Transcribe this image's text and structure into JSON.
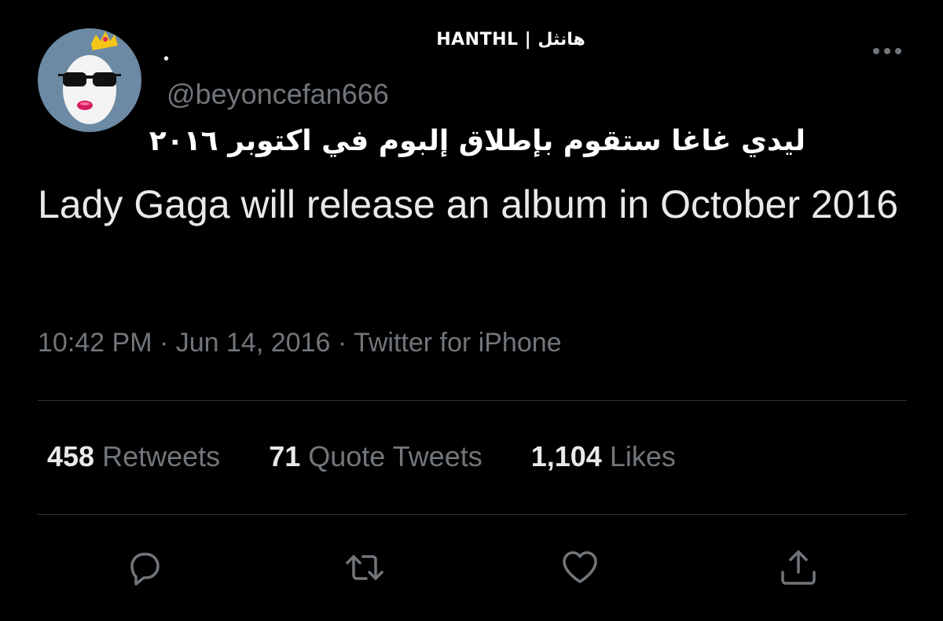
{
  "watermark": "HANTHL | هانثل",
  "author": {
    "display_name": "•",
    "handle": "@beyoncefan666"
  },
  "caption_arabic": "ليدي غاغا ستقوم بإطلاق إلبوم في اكتوبر ٢٠١٦",
  "tweet": {
    "text": "Lady Gaga will release an album in October 2016",
    "time": "10:42 PM",
    "date": "Jun 14, 2016",
    "source": "Twitter for iPhone",
    "separator": " · "
  },
  "stats": {
    "retweets": {
      "count": "458",
      "label": "Retweets"
    },
    "quotes": {
      "count": "71",
      "label": "Quote Tweets"
    },
    "likes": {
      "count": "1,104",
      "label": "Likes"
    }
  },
  "icons": {
    "more": "more-icon",
    "reply": "reply-icon",
    "retweet": "retweet-icon",
    "like": "like-icon",
    "share": "share-icon"
  },
  "colors": {
    "background": "#000000",
    "text_primary": "#e7e9ea",
    "text_secondary": "#71767b",
    "divider": "#2f3336",
    "avatar_bg": "#6c8aa3"
  }
}
